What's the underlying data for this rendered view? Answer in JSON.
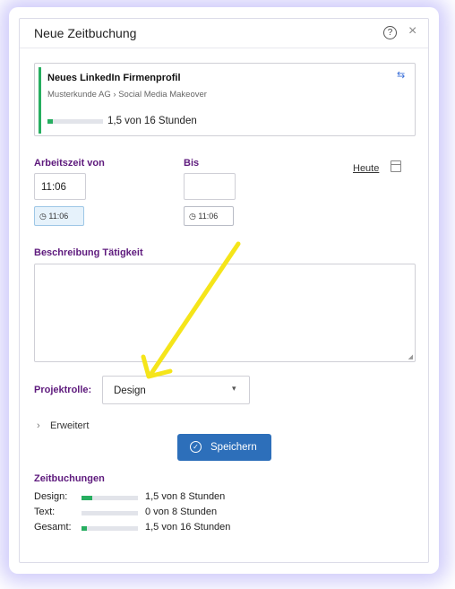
{
  "dialog": {
    "title": "Neue Zeitbuchung",
    "help_glyph": "?",
    "close_glyph": "×"
  },
  "project": {
    "name": "Neues LinkedIn Firmenprofil",
    "path": "Musterkunde AG › Social Media Makeover",
    "hours_text": "1,5 von 16 Stunden",
    "progress_fraction": 0.094,
    "swap_glyph": "⇆",
    "accent_color": "#27ae60"
  },
  "time": {
    "from_label": "Arbeitszeit von",
    "from_value": "11:06",
    "from_now_button": "11:06",
    "to_label": "Bis",
    "to_value": "",
    "to_now_button": "11:06",
    "today_link": "Heute"
  },
  "description": {
    "label": "Beschreibung Tätigkeit",
    "value": ""
  },
  "role": {
    "label": "Projektrolle:",
    "selected": "Design",
    "caret": "▾"
  },
  "advanced": {
    "chevron": "›",
    "label": "Erweitert"
  },
  "save": {
    "label": "Speichern",
    "icon_glyph": "✓",
    "color": "#2d6fba"
  },
  "bookings": {
    "title": "Zeitbuchungen",
    "rows": [
      {
        "name": "Design:",
        "hours_text": "1,5 von 8 Stunden",
        "fraction": 0.1875
      },
      {
        "name": "Text:",
        "hours_text": "0 von 8 Stunden",
        "fraction": 0
      },
      {
        "name": "Gesamt:",
        "hours_text": "1,5 von 16 Stunden",
        "fraction": 0.094
      }
    ]
  },
  "colors": {
    "label_purple": "#5e1a7d",
    "annotation_arrow": "#f5e51a"
  }
}
